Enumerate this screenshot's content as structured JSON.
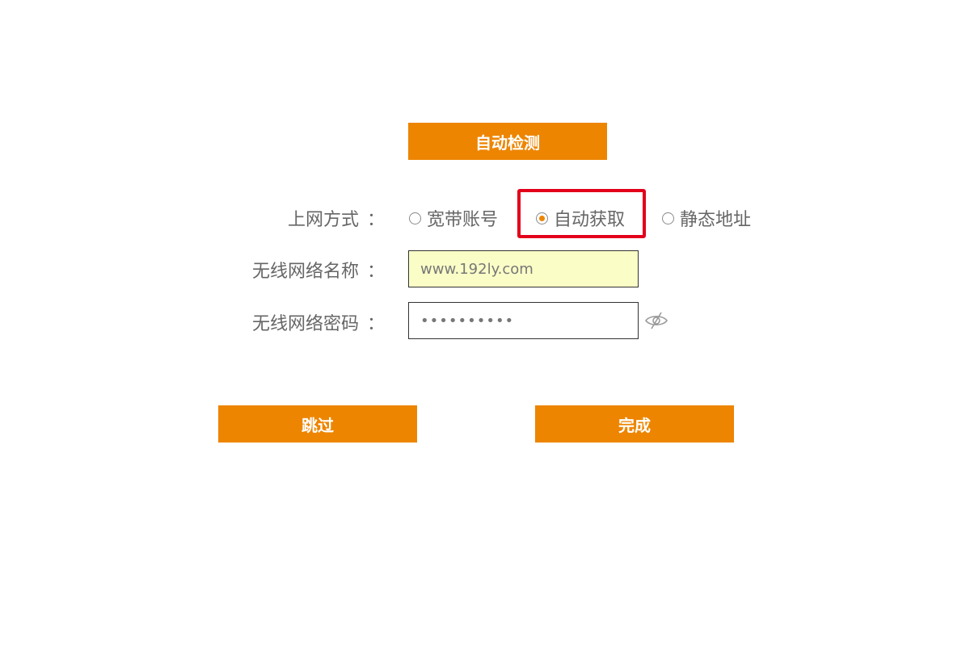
{
  "buttons": {
    "detect": "自动检测",
    "skip": "跳过",
    "done": "完成"
  },
  "connection": {
    "label": "上网方式",
    "colon": "：",
    "options": [
      "宽带账号",
      "自动获取",
      "静态地址"
    ],
    "selected": "自动获取"
  },
  "wifi": {
    "ssid_label": "无线网络名称",
    "ssid_value": "www.192ly.com",
    "password_label": "无线网络密码",
    "password_value": "••••••••••"
  },
  "icons": {
    "password_toggle": "eye-slash-icon"
  },
  "colors": {
    "accent": "#ed8500",
    "highlight": "#e3001b",
    "ssid_background": "#fafdc6"
  }
}
